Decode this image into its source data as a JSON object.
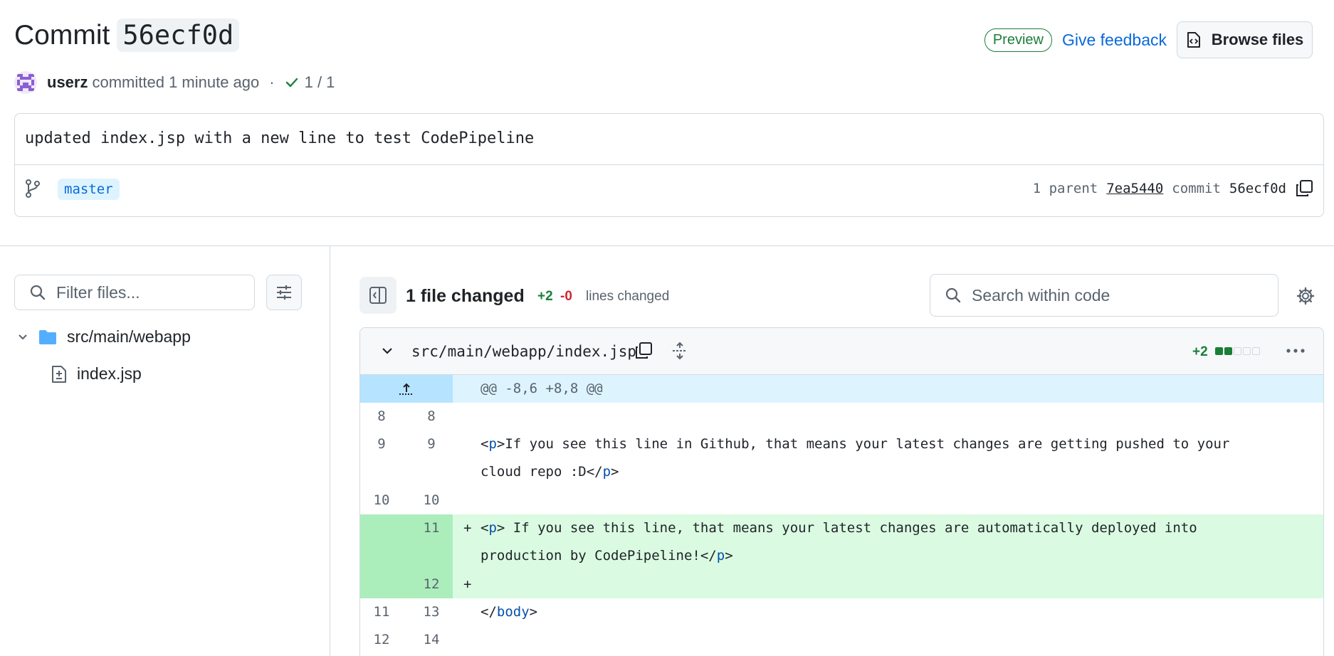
{
  "header": {
    "title_word": "Commit",
    "title_sha": "56ecf0d",
    "preview_label": "Preview",
    "feedback_label": "Give feedback",
    "browse_label": "Browse files"
  },
  "meta": {
    "author": "userz",
    "committed_text": "committed 1 minute ago",
    "separator": "·",
    "checks": "1 / 1"
  },
  "commit": {
    "message": "updated index.jsp with a new line to test CodePipeline",
    "branch": "master",
    "parent_label": "1 parent",
    "parent_sha": "7ea5440",
    "commit_label": "commit",
    "commit_sha": "56ecf0d"
  },
  "sidebar": {
    "filter_placeholder": "Filter files...",
    "folder": "src/main/webapp",
    "file": "index.jsp"
  },
  "toolbar": {
    "files_changed": "1 file changed",
    "additions": "+2",
    "deletions": "-0",
    "lines_changed": "lines changed",
    "search_placeholder": "Search within code"
  },
  "diff": {
    "path": "src/main/webapp/index.jsp",
    "add_count": "+2",
    "hunk": "@@ -8,6 +8,8 @@",
    "rows": [
      {
        "old": "8",
        "new": "8"
      },
      {
        "old": "9",
        "new": "9",
        "open": "<",
        "tag1": "p",
        "text1": ">If you see this line in Github, that means your latest changes are getting pushed to your",
        "text2": "cloud repo :D</",
        "tag2": "p",
        "close": ">"
      },
      {
        "old": "10",
        "new": "10"
      },
      {
        "new": "11",
        "sign": "+",
        "open": "<",
        "tag1": "p",
        "text1": "> If you see this line, that means your latest changes are automatically deployed into",
        "text2": "production by CodePipeline!</",
        "tag2": "p",
        "close": ">"
      },
      {
        "new": "12",
        "sign": "+"
      },
      {
        "old": "11",
        "new": "13",
        "open": "</",
        "tag1": "body",
        "text1": ">"
      },
      {
        "old": "12",
        "new": "14"
      }
    ]
  },
  "colors": {
    "accent": "#0969da",
    "success": "#1a7f37",
    "danger": "#d1242f",
    "added_bg": "#dafbe1",
    "hunk_bg": "#ddf4ff"
  }
}
